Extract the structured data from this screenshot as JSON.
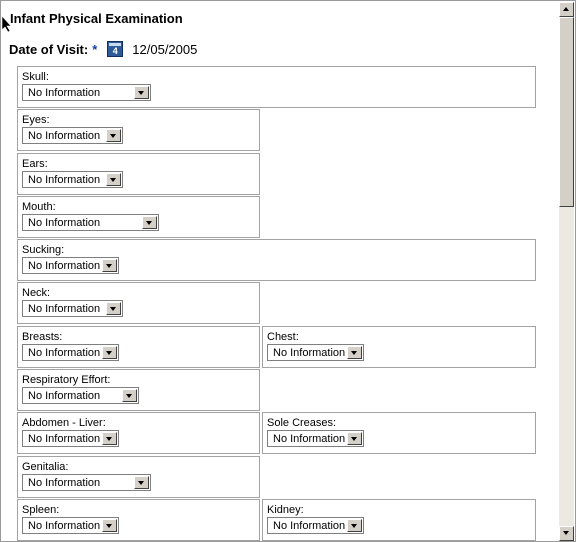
{
  "page": {
    "title": "Infant Physical Examination",
    "date_label": "Date of Visit:",
    "required_marker": "*",
    "calendar_icon_text": "4",
    "date_value": "12/05/2005"
  },
  "fields": {
    "skull": {
      "label": "Skull:",
      "value": "No Information"
    },
    "eyes": {
      "label": "Eyes:",
      "value": "No Information"
    },
    "ears": {
      "label": "Ears:",
      "value": "No Information"
    },
    "mouth": {
      "label": "Mouth:",
      "value": "No Information"
    },
    "sucking": {
      "label": "Sucking:",
      "value": "No Information"
    },
    "neck": {
      "label": "Neck:",
      "value": "No Information"
    },
    "breasts": {
      "label": "Breasts:",
      "value": "No Information"
    },
    "chest": {
      "label": "Chest:",
      "value": "No Information"
    },
    "resp": {
      "label": "Respiratory Effort:",
      "value": "No Information"
    },
    "abdomen": {
      "label": "Abdomen - Liver:",
      "value": "No Information"
    },
    "sole": {
      "label": "Sole Creases:",
      "value": "No Information"
    },
    "genitalia": {
      "label": "Genitalia:",
      "value": "No Information"
    },
    "spleen": {
      "label": "Spleen:",
      "value": "No Information"
    },
    "kidney": {
      "label": "Kidney:",
      "value": "No Information"
    }
  },
  "icons": {
    "calendar": "calendar-icon",
    "dropdown": "chevron-down-icon",
    "cursor": "mouse-pointer-icon"
  },
  "colors": {
    "required_marker": "#1b3fa8",
    "calendar_icon": "#2e5a98",
    "control_face": "#d4d0c8"
  }
}
